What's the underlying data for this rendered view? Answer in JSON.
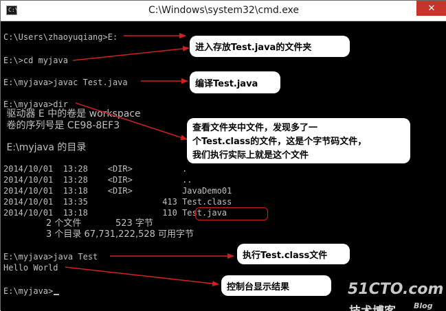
{
  "window": {
    "title": "C:\\Windows\\system32\\cmd.exe",
    "icon_text": "C:\\",
    "close_glyph": "✕"
  },
  "console": {
    "lines": [
      "C:\\Users\\zhaoyuqiang>E:",
      "E:\\>cd myjava",
      "E:\\myjava>javac Test.java",
      "E:\\myjava>dir",
      " 驱动器 E 中的卷是 workspace",
      " 卷的序列号是 CE98-8EF3",
      " E:\\myjava 的目录",
      "2014/10/01  13:28    <DIR>          .",
      "2014/10/01  13:28    <DIR>          ..",
      "2014/10/01  13:18    <DIR>          JavaDemo01",
      "2014/10/01  13:35               413 Test.class",
      "2014/10/01  13:18               110 Test.java",
      "               2 个文件            523 字节",
      "               3 个目录 67,731,222,528 可用字节",
      "E:\\myjava>java Test",
      "Hello World",
      "E:\\myjava>"
    ]
  },
  "annotations": {
    "enter_folder": "进入存放Test.java的文件夹",
    "compile": "编译Test.java",
    "dir_note": [
      "查看文件夹中文件，发现多了一",
      "个Test.class的文件，这是个字节码文件，",
      "我们执行实际上就是这个文件"
    ],
    "run": "执行Test.class文件",
    "output": "控制台显示结果"
  },
  "watermark": {
    "main": "51CTO.com",
    "sub": "技术博客",
    "blog": "Blog"
  },
  "colors": {
    "console_bg": "#000000",
    "console_text": "#c0c0c0",
    "arrow": "#d22020",
    "close_button": "#c7342b"
  }
}
